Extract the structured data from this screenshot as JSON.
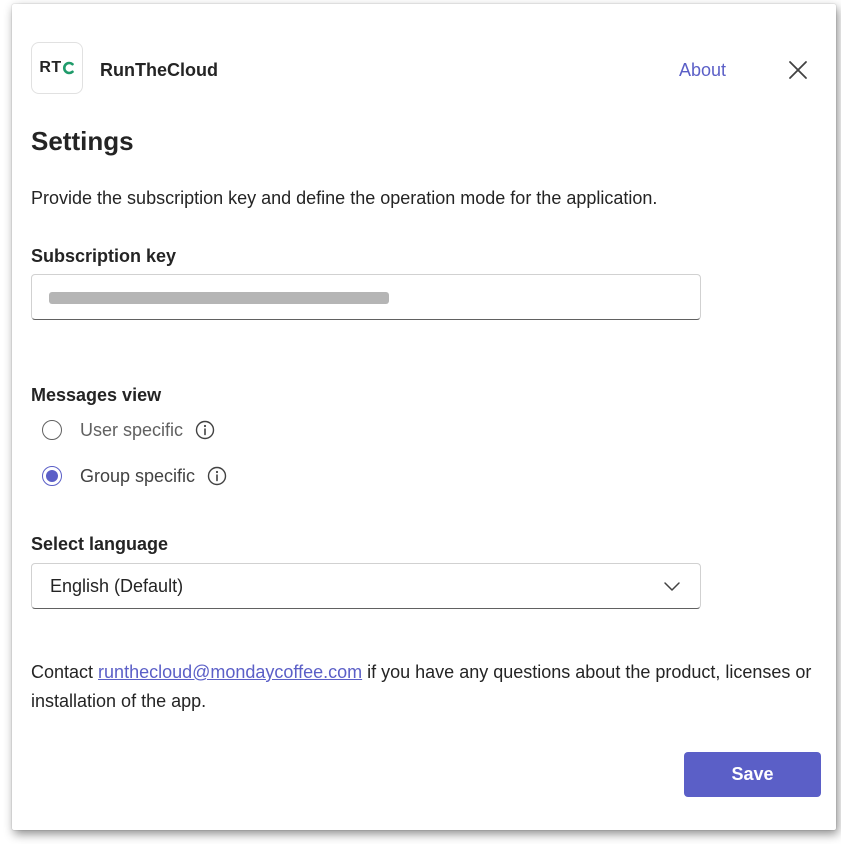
{
  "header": {
    "logo_text": "RT",
    "app_name": "RunTheCloud",
    "about_label": "About",
    "close_icon": "close-icon",
    "brand_color": "#1f9b6a"
  },
  "page": {
    "title": "Settings",
    "description": "Provide the subscription key and define the operation mode for the application."
  },
  "subscription": {
    "label": "Subscription key"
  },
  "messages_view": {
    "label": "Messages view",
    "options": [
      {
        "label": "User specific",
        "selected": false,
        "icon": "info-icon"
      },
      {
        "label": "Group specific",
        "selected": true,
        "icon": "info-icon"
      }
    ]
  },
  "language": {
    "label": "Select language",
    "selected": "English (Default)",
    "icon": "chevron-down-icon"
  },
  "contact": {
    "prefix": "Contact ",
    "email": "runthecloud@mondaycoffee.com",
    "suffix": " if you have any questions about the product, licenses or installation of the app."
  },
  "footer": {
    "save_label": "Save"
  },
  "colors": {
    "accent": "#5b5fc7",
    "text": "#242424"
  }
}
